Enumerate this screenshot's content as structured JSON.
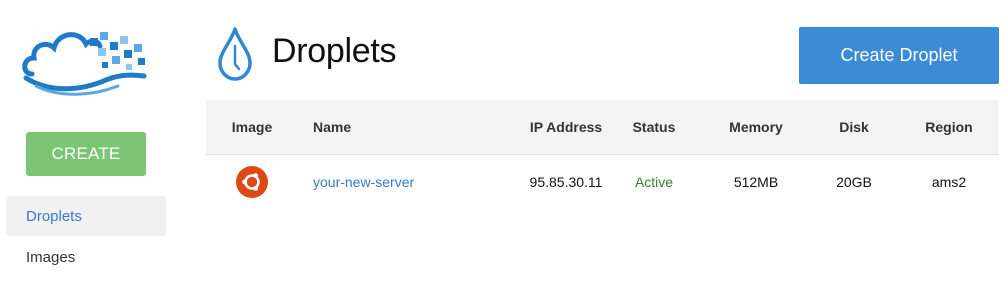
{
  "sidebar": {
    "create_label": "CREATE",
    "items": [
      {
        "label": "Droplets",
        "active": true
      },
      {
        "label": "Images",
        "active": false
      }
    ]
  },
  "header": {
    "title": "Droplets",
    "primary_button": "Create Droplet"
  },
  "table": {
    "columns": [
      "Image",
      "Name",
      "IP Address",
      "Status",
      "Memory",
      "Disk",
      "Region"
    ],
    "rows": [
      {
        "image_icon": "ubuntu-icon",
        "name": "your-new-server",
        "ip": "95.85.30.11",
        "status": "Active",
        "memory": "512MB",
        "disk": "20GB",
        "region": "ams2"
      }
    ]
  },
  "colors": {
    "brand_blue": "#3b8bd6",
    "create_green": "#7cc576",
    "link_blue": "#3a79c8",
    "active_green": "#3d7e2e",
    "ubuntu_orange": "#dd4814"
  }
}
